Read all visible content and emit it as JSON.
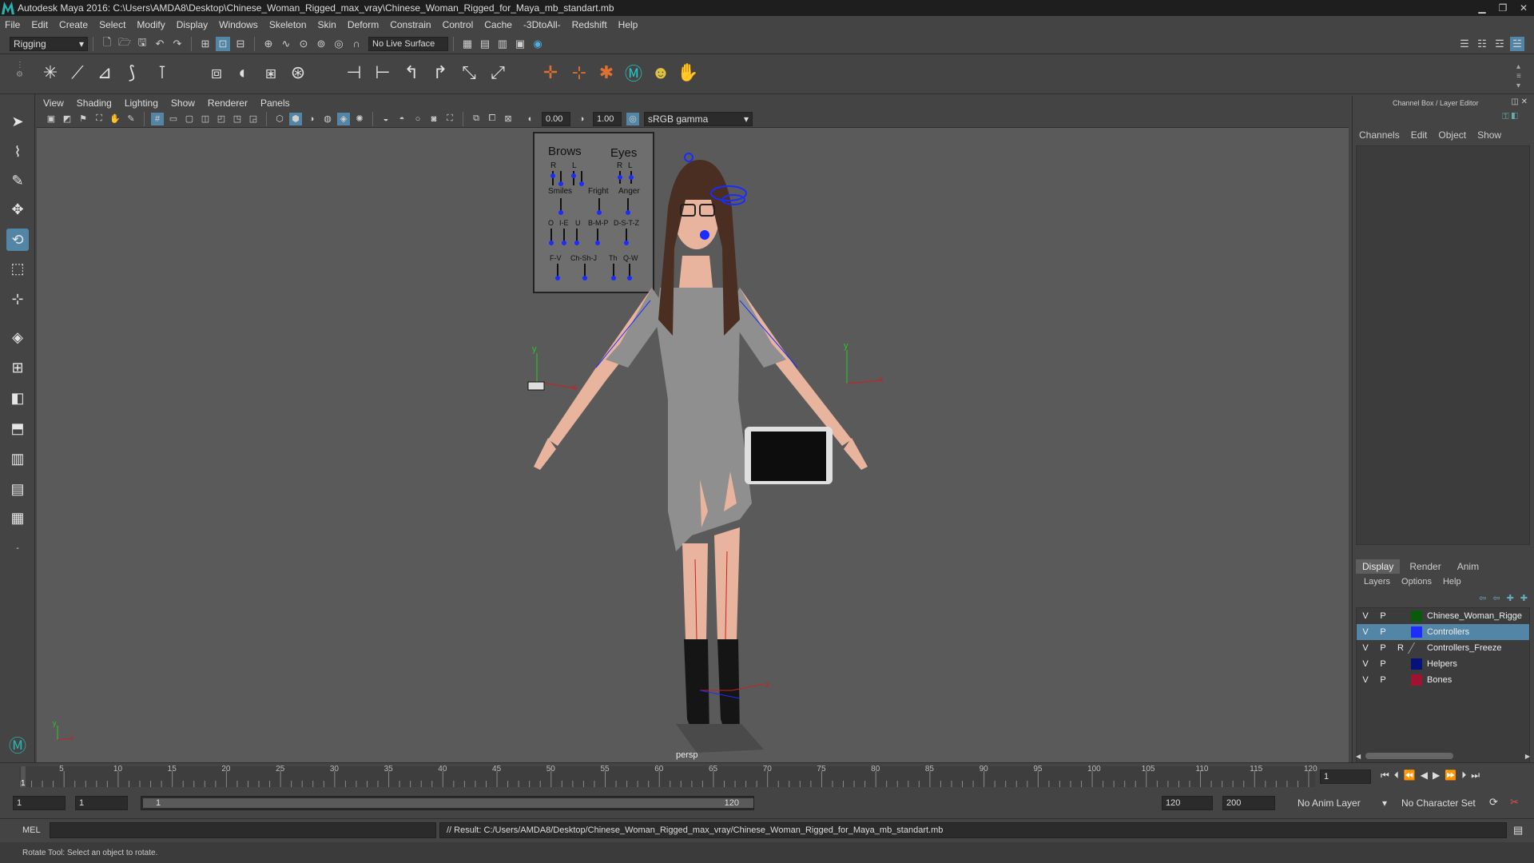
{
  "titlebar": {
    "title": "Autodesk Maya 2016: C:\\Users\\AMDA8\\Desktop\\Chinese_Woman_Rigged_max_vray\\Chinese_Woman_Rigged_for_Maya_mb_standart.mb"
  },
  "menubar": [
    "File",
    "Edit",
    "Create",
    "Select",
    "Modify",
    "Display",
    "Windows",
    "Skeleton",
    "Skin",
    "Deform",
    "Constrain",
    "Control",
    "Cache",
    "-3DtoAll-",
    "Redshift",
    "Help"
  ],
  "statusline": {
    "menuset": "Rigging",
    "live_surface": "No Live Surface"
  },
  "viewport": {
    "menu": [
      "View",
      "Shading",
      "Lighting",
      "Show",
      "Renderer",
      "Panels"
    ],
    "exposure": "0.00",
    "gamma": "1.00",
    "color_space": "sRGB gamma",
    "camera_label": "persp"
  },
  "face_panel": {
    "brows": "Brows",
    "eyes": "Eyes",
    "brow_r": "R",
    "brow_l": "L",
    "eye_r": "R",
    "eye_l": "L",
    "smiles": "Smiles",
    "fright": "Fright",
    "anger": "Anger",
    "row3": [
      "O",
      "I-E",
      "U",
      "B-M-P",
      "D-S-T-Z"
    ],
    "row4": [
      "F-V",
      "Ch-Sh-J",
      "Th",
      "Q-W"
    ]
  },
  "channelbox": {
    "header": "Channel Box / Layer Editor",
    "menu": [
      "Channels",
      "Edit",
      "Object",
      "Show"
    ],
    "tabs": [
      "Display",
      "Render",
      "Anim"
    ],
    "layer_menu": [
      "Layers",
      "Options",
      "Help"
    ],
    "layers": [
      {
        "v": "V",
        "p": "P",
        "r": "",
        "name": "Chinese_Woman_Rigge",
        "color": "#0b5a0b"
      },
      {
        "v": "V",
        "p": "P",
        "r": "",
        "name": "Controllers",
        "color": "#1f2cff"
      },
      {
        "v": "V",
        "p": "P",
        "r": "R",
        "name": "Controllers_Freeze",
        "color": ""
      },
      {
        "v": "V",
        "p": "P",
        "r": "",
        "name": "Helpers",
        "color": "#06127a"
      },
      {
        "v": "V",
        "p": "P",
        "r": "",
        "name": "Bones",
        "color": "#a01232"
      }
    ]
  },
  "timeline": {
    "ticks": [
      "5",
      "10",
      "15",
      "20",
      "25",
      "30",
      "35",
      "40",
      "45",
      "50",
      "55",
      "60",
      "65",
      "70",
      "75",
      "80",
      "85",
      "90",
      "95",
      "100",
      "105",
      "110",
      "115",
      "120"
    ],
    "current_marker": "1",
    "current_frame": "1"
  },
  "range": {
    "start": "1",
    "playback_start": "1",
    "slider_start": "1",
    "slider_end": "120",
    "playback_end": "120",
    "end": "200",
    "anim_layer": "No Anim Layer",
    "character_set": "No Character Set"
  },
  "cmd": {
    "lang": "MEL",
    "result": "// Result: C:/Users/AMDA8/Desktop/Chinese_Woman_Rigged_max_vray/Chinese_Woman_Rigged_for_Maya_mb_standart.mb"
  },
  "help": "Rotate Tool: Select an object to rotate.",
  "colors": {
    "accent": "#5285a6",
    "viewport_bg": "#5a5a5a",
    "panel": "#444444"
  }
}
